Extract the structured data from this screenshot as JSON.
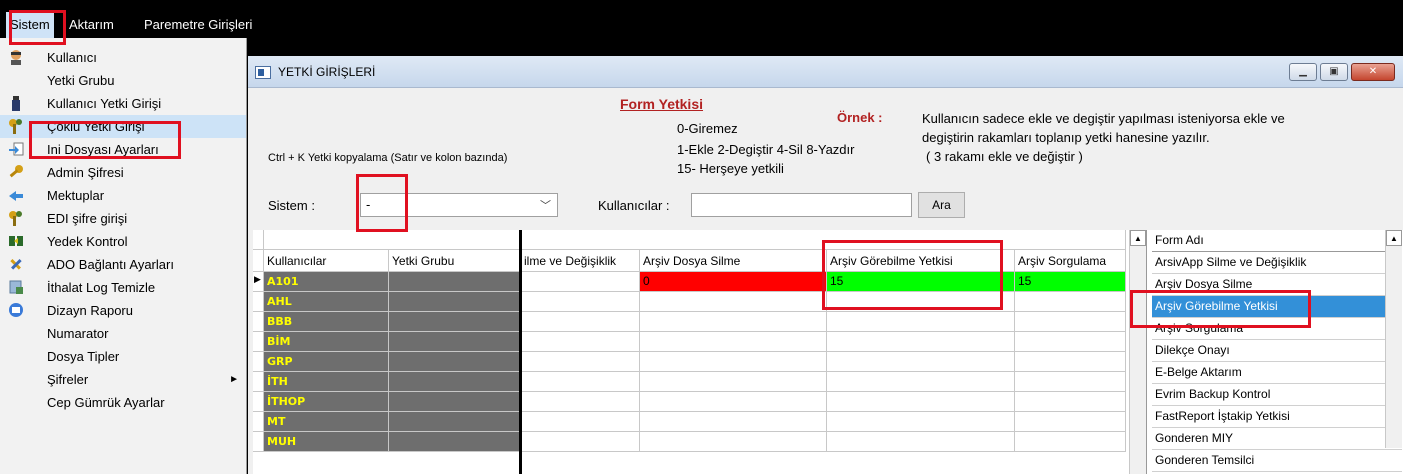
{
  "menubar": [
    {
      "label": "Sistem",
      "ul": "S"
    },
    {
      "label": "Aktarım",
      "ul": "A"
    },
    {
      "label": "Paremetre Girişleri",
      "ul": ""
    }
  ],
  "dropdown": {
    "items": [
      {
        "label": "Kullanıcı",
        "icon": "user-icon"
      },
      {
        "label": "Yetki Grubu",
        "icon": ""
      },
      {
        "label": "Kullanıcı Yetki Girişi",
        "icon": "bottle-icon"
      },
      {
        "label": "Çoklu Yetki Girişi",
        "icon": "keys-icon"
      },
      {
        "label": "Ini Dosyası  Ayarları",
        "icon": "arrow-doc-icon"
      },
      {
        "label": "Admin Şifresi",
        "icon": "key-icon"
      },
      {
        "label": "Mektuplar",
        "icon": "envelope-icon"
      },
      {
        "label": "EDI şifre girişi",
        "icon": "keys-icon"
      },
      {
        "label": "Yedek Kontrol",
        "icon": "transfer-icon"
      },
      {
        "label": "ADO Bağlantı Ayarları",
        "icon": "tools-icon"
      },
      {
        "label": "İthalat Log Temizle",
        "icon": "clean-icon"
      },
      {
        "label": "Dizayn Raporu",
        "icon": "report-icon"
      },
      {
        "label": "Numarator",
        "icon": ""
      },
      {
        "label": "Dosya Tipler",
        "icon": ""
      },
      {
        "label": "Şifreler",
        "icon": "",
        "submenu": "►"
      },
      {
        "label": "Cep Gümrük Ayarlar",
        "icon": ""
      }
    ]
  },
  "window": {
    "title": "YETKİ GİRİŞLERİ",
    "buttons": {
      "minimize": "▁",
      "maximize": "▣",
      "close": "✕"
    },
    "form_title": "Form Yetkisi",
    "legend": [
      "0-Giremez",
      "1-Ekle  2-Degiştir  4-Sil  8-Yazdır",
      "15- Herşeye yetkili"
    ],
    "ornek_label": "Örnek :",
    "ornek_text": [
      "Kullanıcın sadece ekle ve degiştir yapılması isteniyorsa  ekle ve",
      "degiştirin rakamları toplanıp yetki hanesine yazılır.",
      "( 3 rakamı ekle ve değiştir )"
    ],
    "ctrl_note": "Ctrl + K Yetki kopyalama (Satır ve kolon bazında)",
    "sistem_label": "Sistem :",
    "sistem_value": "-",
    "kullanicilar_label": "Kullanıcılar :",
    "kullanicilar_value": "",
    "ara_label": "Ara"
  },
  "grid": {
    "columns": [
      "Kullanıcılar",
      "Yetki Grubu",
      "ilme ve Değişiklik",
      "Arşiv Dosya Silme",
      "Arşiv Görebilme Yetkisi",
      "Arşiv Sorgulama"
    ],
    "rows": [
      {
        "user": "A101",
        "values": [
          "",
          "0",
          "15",
          "15"
        ],
        "active": true
      },
      {
        "user": "AHL",
        "values": [
          "",
          "",
          "",
          ""
        ]
      },
      {
        "user": "BBB",
        "values": [
          "",
          "",
          "",
          ""
        ]
      },
      {
        "user": "BİM",
        "values": [
          "",
          "",
          "",
          ""
        ]
      },
      {
        "user": "GRP",
        "values": [
          "",
          "",
          "",
          ""
        ]
      },
      {
        "user": "İTH",
        "values": [
          "",
          "",
          "",
          ""
        ]
      },
      {
        "user": "İTHOP",
        "values": [
          "",
          "",
          "",
          ""
        ]
      },
      {
        "user": "MT",
        "values": [
          "",
          "",
          "",
          ""
        ]
      },
      {
        "user": "MUH",
        "values": [
          "",
          "",
          "",
          ""
        ]
      }
    ],
    "colors": {
      "red": "#ff0000",
      "green": "#00ff00"
    }
  },
  "form_list": {
    "header": "Form Adı",
    "items": [
      "ArsivApp Silme ve Değişiklik",
      "Arşiv Dosya Silme",
      "Arşiv Görebilme Yetkisi",
      "Arşiv Sorgulama",
      "Dilekçe Onayı",
      "E-Belge Aktarım",
      "Evrim Backup Kontrol",
      "FastReport İştakip Yetkisi",
      "Gonderen MIY",
      "Gonderen Temsilci"
    ],
    "selected": "Arşiv Görebilme Yetkisi"
  }
}
